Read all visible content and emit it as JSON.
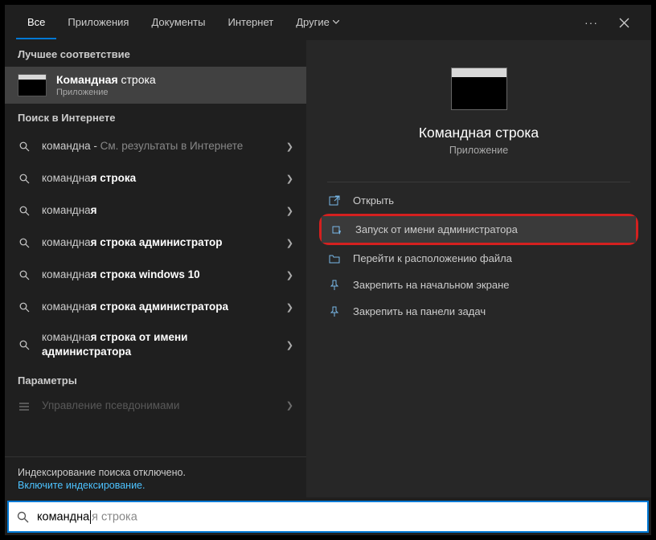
{
  "tabs": {
    "all": "Все",
    "apps": "Приложения",
    "docs": "Документы",
    "web": "Интернет",
    "other": "Другие"
  },
  "sections": {
    "best_match": "Лучшее соответствие",
    "web_search": "Поиск в Интернете",
    "settings": "Параметры"
  },
  "best_match": {
    "title_html": "Командная строка",
    "subtitle": "Приложение"
  },
  "web_results": [
    {
      "prefix": "командна",
      "bold": "",
      "suffix": " - ",
      "extra": "См. результаты в Интернете"
    },
    {
      "prefix": "командна",
      "bold": "я строка",
      "suffix": "",
      "extra": ""
    },
    {
      "prefix": "командна",
      "bold": "я",
      "suffix": "",
      "extra": ""
    },
    {
      "prefix": "командна",
      "bold": "я строка администратор",
      "suffix": "",
      "extra": ""
    },
    {
      "prefix": "командна",
      "bold": "я строка windows 10",
      "suffix": "",
      "extra": ""
    },
    {
      "prefix": "командна",
      "bold": "я строка администратора",
      "suffix": "",
      "extra": ""
    },
    {
      "prefix": "командна",
      "bold": "я строка от имени администратора",
      "suffix": "",
      "extra": ""
    }
  ],
  "settings_row": "Управление псевдонимами",
  "indexing": {
    "note": "Индексирование поиска отключено.",
    "link": "Включите индексирование."
  },
  "detail": {
    "title": "Командная строка",
    "subtitle": "Приложение",
    "actions": {
      "open": "Открыть",
      "admin": "Запуск от имени администратора",
      "location": "Перейти к расположению файла",
      "pin_start": "Закрепить на начальном экране",
      "pin_taskbar": "Закрепить на панели задач"
    }
  },
  "search": {
    "typed": "командна",
    "ghost": "я строка"
  }
}
